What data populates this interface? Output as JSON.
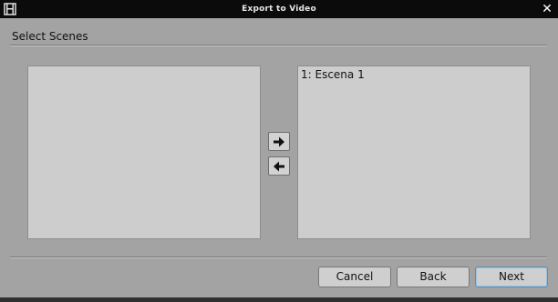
{
  "window": {
    "title": "Export to Video",
    "close_glyph": "✕",
    "app_icon": "film-icon"
  },
  "section": {
    "label": "Select Scenes"
  },
  "available_list": {
    "items": []
  },
  "selected_list": {
    "items": [
      "1: Escena 1"
    ]
  },
  "transfer": {
    "add_icon": "arrow-right-icon",
    "remove_icon": "arrow-left-icon"
  },
  "buttons": {
    "cancel": "Cancel",
    "back": "Back",
    "next": "Next"
  },
  "colors": {
    "background": "#a3a3a3",
    "titlebar": "#0b0b0b",
    "list_bg": "#cdcdcd",
    "default_button_accent": "#5a8fb8"
  }
}
